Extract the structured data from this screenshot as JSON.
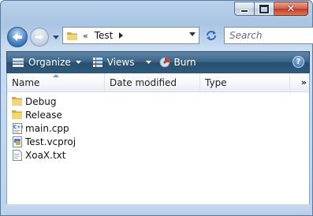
{
  "window": {
    "controls": {
      "minimize": "minimize",
      "maximize": "maximize",
      "close": "close"
    }
  },
  "address_bar": {
    "separator": "«",
    "current_folder": "Test",
    "icon": "folder-icon"
  },
  "search": {
    "placeholder": "Search"
  },
  "toolbar": {
    "organize_label": "Organize",
    "views_label": "Views",
    "burn_label": "Burn",
    "help_label": "?"
  },
  "columns": {
    "name": "Name",
    "date_modified": "Date modified",
    "type": "Type",
    "more": "»"
  },
  "files": [
    {
      "name": "Debug",
      "icon": "folder-icon"
    },
    {
      "name": "Release",
      "icon": "folder-icon"
    },
    {
      "name": "main.cpp",
      "icon": "cpp-file-icon"
    },
    {
      "name": "Test.vcproj",
      "icon": "vcproj-file-icon"
    },
    {
      "name": "XoaX.txt",
      "icon": "text-file-icon"
    }
  ],
  "colors": {
    "toolbar": "#3b6488",
    "frame": "#b9d1ea",
    "folder": "#e8c65a",
    "close": "#c23a1f"
  }
}
